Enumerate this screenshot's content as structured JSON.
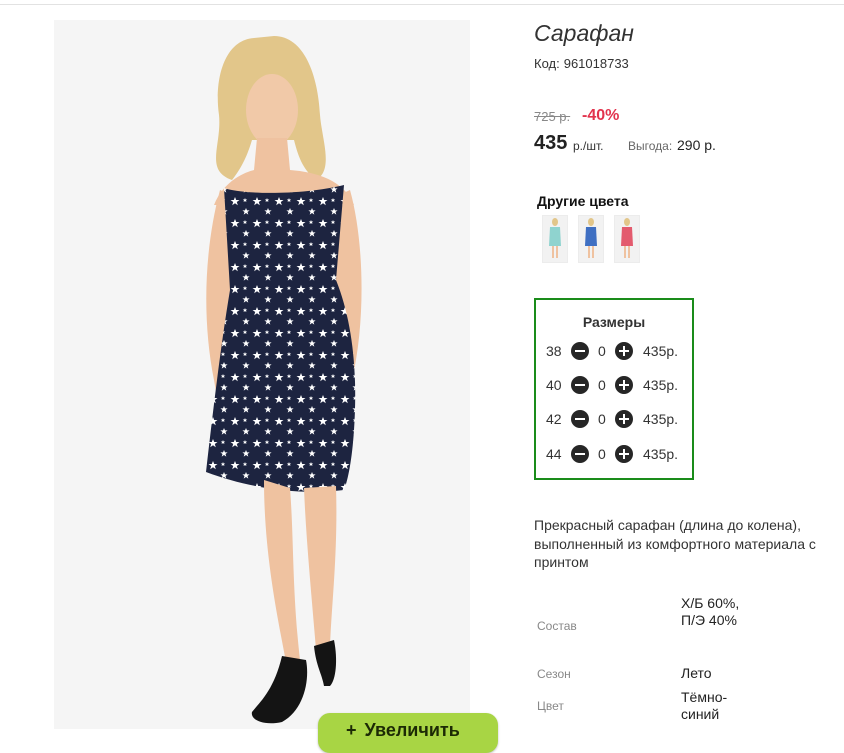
{
  "product": {
    "title": "Сарафан",
    "code_label": "Код:",
    "code": "961018733",
    "old_price": "725 р.",
    "discount": "-40%",
    "price": "435",
    "price_unit": "р./шт.",
    "benefit_label": "Выгода:",
    "benefit_value": "290 р."
  },
  "image": {
    "zoom_button_label": "Увеличить",
    "zoom_icon": "plus-icon"
  },
  "other_colors": {
    "title": "Другие цвета",
    "swatches": [
      {
        "name": "mint",
        "color": "#8fd3cf"
      },
      {
        "name": "blue",
        "color": "#3f6fc2"
      },
      {
        "name": "coral",
        "color": "#e35b6e"
      }
    ]
  },
  "sizes": {
    "title": "Размеры",
    "rows": [
      {
        "size": "38",
        "qty": "0",
        "price": "435р."
      },
      {
        "size": "40",
        "qty": "0",
        "price": "435р."
      },
      {
        "size": "42",
        "qty": "0",
        "price": "435р."
      },
      {
        "size": "44",
        "qty": "0",
        "price": "435р."
      }
    ]
  },
  "description": "Прекрасный сарафан (длина до колена), выполненный из комфортного материала с принтом",
  "specs": [
    {
      "label": "Состав",
      "value": "Х/Б 60%, П/Э 40%"
    },
    {
      "label": "Сезон",
      "value": "Лето"
    },
    {
      "label": "Цвет",
      "value": "Тёмно-синий"
    }
  ],
  "colors": {
    "accent_red": "#e2334d",
    "sizes_border": "#1a8c1a",
    "zoom_button": "#a8d544",
    "dress": "#1d2440"
  }
}
